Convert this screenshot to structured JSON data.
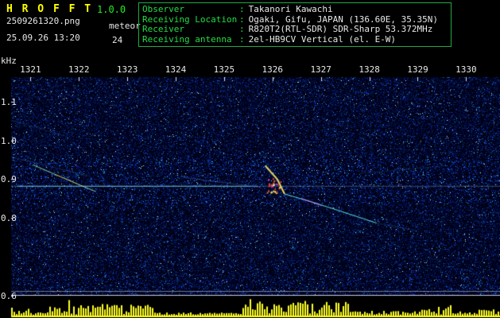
{
  "header": {
    "app_title": "H R O F F T",
    "version": "1.0.0",
    "filename": "2509261320.png",
    "mode": "meteor",
    "datetime": "25.09.26 13:20",
    "count": "24",
    "separator": ":",
    "info": [
      {
        "label": "Observer",
        "value": "Takanori Kawachi"
      },
      {
        "label": "Receiving Location",
        "value": "Ogaki, Gifu, JAPAN (136.60E, 35.35N)"
      },
      {
        "label": "Receiver",
        "value": "R820T2(RTL-SDR) SDR-Sharp 53.372MHz"
      },
      {
        "label": "Receiving antenna",
        "value": "2el-HB9CV Vertical (el. E-W)"
      }
    ]
  },
  "colors": {
    "background": "#000000",
    "brand_yellow": "#ffff00",
    "label_green": "#22dd44",
    "value_white": "#e8e8e8",
    "axis_text": "#e8e8e8",
    "bar_yellow": "#ffff22",
    "info_border": "#22aa44"
  },
  "chart_data": {
    "type": "heatmap",
    "title": "",
    "xlabel": "",
    "ylabel": "kHz",
    "x_axis": {
      "label": "",
      "ticks": [
        1321,
        1322,
        1323,
        1324,
        1325,
        1326,
        1327,
        1328,
        1329,
        1330
      ],
      "range": [
        1320.6,
        1330.7
      ]
    },
    "y_axis": {
      "label": "kHz",
      "ticks": [
        1.1,
        1.0,
        0.9,
        0.8,
        0.6
      ],
      "range": [
        0.6,
        1.163
      ]
    },
    "carrier_khz": 0.882,
    "traces": [
      {
        "name": "carrier-line-dim",
        "points": [
          [
            1320.6,
            0.882
          ],
          [
            1330.7,
            0.882
          ]
        ],
        "color": "#7788aa",
        "alpha": 0.5,
        "width": 1
      },
      {
        "name": "carrier-line-bright",
        "points": [
          [
            1320.72,
            0.882
          ],
          [
            1325.7,
            0.882
          ]
        ],
        "color": "#77ddee",
        "alpha": 0.75,
        "width": 1
      },
      {
        "name": "meteor-echo-left-1",
        "points": [
          [
            1321.05,
            0.937
          ],
          [
            1321.5,
            0.913
          ]
        ],
        "color": "#99ee99",
        "alpha": 0.85,
        "width": 1
      },
      {
        "name": "meteor-echo-left-2",
        "points": [
          [
            1321.5,
            0.913
          ],
          [
            1321.95,
            0.889
          ]
        ],
        "color": "#eeee77",
        "alpha": 0.9,
        "width": 1
      },
      {
        "name": "meteor-echo-left-3",
        "points": [
          [
            1321.95,
            0.889
          ],
          [
            1322.35,
            0.868
          ]
        ],
        "color": "#aaffcc",
        "alpha": 0.8,
        "width": 1
      },
      {
        "name": "meteor-echo-main-head",
        "points": [
          [
            1325.85,
            0.935
          ],
          [
            1326.1,
            0.9
          ],
          [
            1326.25,
            0.862
          ]
        ],
        "color": "#ffee66",
        "alpha": 0.9,
        "width": 2
      },
      {
        "name": "meteor-echo-main-tail",
        "points": [
          [
            1326.25,
            0.862
          ],
          [
            1326.8,
            0.842
          ],
          [
            1327.4,
            0.818
          ],
          [
            1328.15,
            0.787
          ]
        ],
        "color": "#66ffee",
        "alpha": 0.85,
        "width": 1
      },
      {
        "name": "meteor-echo-main-tail-magenta",
        "points": [
          [
            1326.6,
            0.85
          ],
          [
            1327.0,
            0.833
          ]
        ],
        "color": "#ee77ff",
        "alpha": 0.8,
        "width": 1
      },
      {
        "name": "faint-streak-mid",
        "points": [
          [
            1324.15,
            0.905
          ],
          [
            1325.75,
            0.879
          ]
        ],
        "color": "#4466aa",
        "alpha": 0.5,
        "width": 1
      },
      {
        "name": "faint-streak-left",
        "points": [
          [
            1320.6,
            0.958
          ],
          [
            1322.2,
            0.908
          ]
        ],
        "color": "#33558a",
        "alpha": 0.45,
        "width": 1
      },
      {
        "name": "faint-streak-topleft",
        "points": [
          [
            1320.6,
            1.052
          ],
          [
            1321.7,
            1.012
          ]
        ],
        "color": "#2a4a7a",
        "alpha": 0.4,
        "width": 1
      },
      {
        "name": "faint-streak-right",
        "points": [
          [
            1328.15,
            0.787
          ],
          [
            1328.95,
            0.768
          ]
        ],
        "color": "#335588",
        "alpha": 0.4,
        "width": 1
      },
      {
        "name": "faint-streak-upper-right",
        "points": [
          [
            1327.8,
            0.915
          ],
          [
            1329.6,
            0.935
          ]
        ],
        "color": "#2f4f7f",
        "alpha": 0.35,
        "width": 1
      }
    ],
    "strong_echo": {
      "t": 1326.02,
      "f": 0.885,
      "spread_t": 0.14,
      "spread_f": 0.022,
      "colors": [
        "#ff4433",
        "#ff7733",
        "#ff55cc",
        "#ffee44",
        "#ff2222"
      ]
    },
    "gridlines": [
      {
        "f": 0.612,
        "alpha": 0.5
      },
      {
        "f": 0.603,
        "alpha": 0.9
      }
    ],
    "activity_bars": {
      "unit": "relative signal level 0-1 per time segment [t_start,t_end,level]",
      "segments": [
        [
          1320.6,
          1320.95,
          0.5
        ],
        [
          1320.95,
          1321.3,
          0.15
        ],
        [
          1321.3,
          1323.55,
          0.7
        ],
        [
          1323.55,
          1325.35,
          0.15
        ],
        [
          1325.35,
          1327.55,
          0.9
        ],
        [
          1327.55,
          1329.0,
          0.25
        ],
        [
          1329.0,
          1329.7,
          0.5
        ],
        [
          1329.7,
          1330.2,
          0.15
        ],
        [
          1330.2,
          1330.7,
          0.35
        ]
      ]
    },
    "noise_seed": 20250926
  }
}
